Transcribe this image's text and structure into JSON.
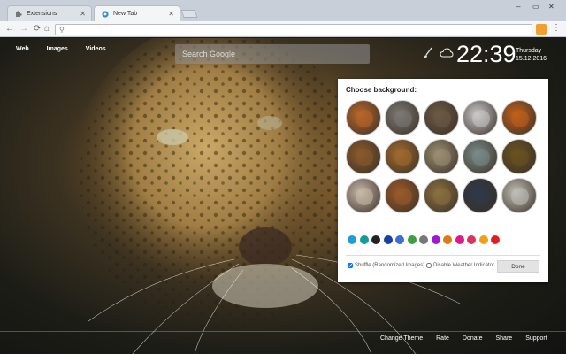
{
  "browser": {
    "tabs": [
      {
        "title": "Extensions",
        "active": false
      },
      {
        "title": "New Tab",
        "active": true
      }
    ],
    "address_value": "",
    "window_controls": [
      "minimize",
      "maximize",
      "close"
    ]
  },
  "page": {
    "nav_links": [
      "Web",
      "Images",
      "Videos"
    ],
    "search_placeholder": "Search Google",
    "weather_icon": "cloud-icon",
    "clock": {
      "time": "22:39",
      "day": "Thursday",
      "date": "15.12.2016"
    },
    "panel": {
      "title": "Choose background:",
      "thumbnail_colors": [
        [
          "#b8662a",
          "#7a7874",
          "#6b5a46",
          "#c8c8c8",
          "#c0601a"
        ],
        [
          "#8a5a2c",
          "#a06a2e",
          "#9a8e72",
          "#7a8a88",
          "#6a5220"
        ],
        [
          "#c8b8a8",
          "#9a5a2a",
          "#8a7040",
          "#303848",
          "#c0bfb8"
        ]
      ],
      "swatch_colors": [
        "#1e9ed8",
        "#159a9a",
        "#222222",
        "#1a3fa0",
        "#3a6ed8",
        "#3aa040",
        "#777777",
        "#9a1ad8",
        "#e07a10",
        "#e0188a",
        "#e03060",
        "#f0a010",
        "#e02020"
      ],
      "shuffle_label": "Shuffle (Randomized Images)",
      "shuffle_checked": true,
      "disable_weather_label": "Disable Weather Indicator",
      "disable_weather_checked": false,
      "done_label": "Done"
    },
    "footer_links": [
      "Change Theme",
      "Rate",
      "Donate",
      "Share",
      "Support"
    ]
  }
}
